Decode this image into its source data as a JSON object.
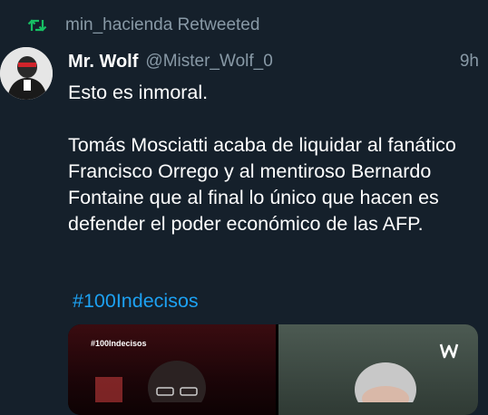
{
  "retweet": {
    "label": "min_hacienda Retweeted"
  },
  "author": {
    "display_name": "Mr. Wolf",
    "handle": "@Mister_Wolf_0"
  },
  "timestamp": "9h",
  "tweet": {
    "text": "Esto es inmoral.\n\nTomás Mosciatti acaba de liquidar al fanático Francisco Orrego y al mentiroso Bernardo Fontaine que al final lo único que hacen es defender el poder económico de las AFP.",
    "hashtag": "#100Indecisos"
  },
  "media": {
    "overlay_tag": "#100Indecisos"
  },
  "icons": {
    "retweet": "retweet-icon",
    "avatar": "avatar-image",
    "watermark": "video-brand-icon"
  },
  "colors": {
    "background": "#15202b",
    "muted": "#8899a6",
    "link": "#1da1f2",
    "retweet_icon": "#17bf63"
  }
}
